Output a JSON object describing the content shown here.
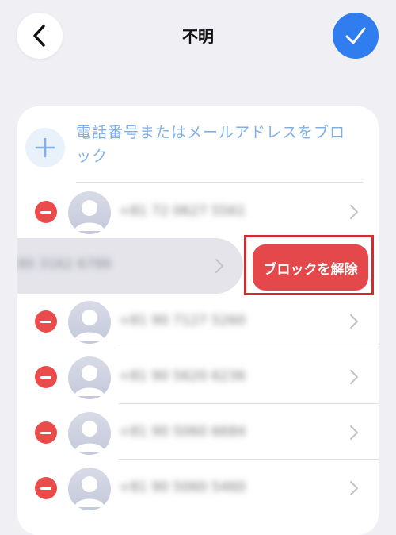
{
  "header": {
    "title": "不明",
    "back_icon": "chevron-left-icon",
    "confirm_icon": "checkmark-icon"
  },
  "add_entry": {
    "label": "電話番号またはメールアドレスをブロック",
    "icon": "plus-icon"
  },
  "swipe_action": {
    "label": "ブロックを解除",
    "color": "#e5484b"
  },
  "blocked_contacts": [
    {
      "text": "+81 72 0627 5561",
      "remove_icon": "remove-minus-icon",
      "chevron": "chevron-right-icon"
    },
    {
      "text": "80 3162 6786",
      "swiped": true,
      "chevron": "chevron-right-icon"
    },
    {
      "text": "+81 90 7127 5260",
      "remove_icon": "remove-minus-icon",
      "chevron": "chevron-right-icon"
    },
    {
      "text": "+81 90 5620 6236",
      "remove_icon": "remove-minus-icon",
      "chevron": "chevron-right-icon"
    },
    {
      "text": "+81 90 5060 6684",
      "remove_icon": "remove-minus-icon",
      "chevron": "chevron-right-icon"
    },
    {
      "text": "+81 90 5060 5460",
      "remove_icon": "remove-minus-icon",
      "chevron": "chevron-right-icon"
    }
  ],
  "colors": {
    "background": "#efeff4",
    "accent": "#2f7dee",
    "destructive": "#ea4b4b",
    "add_text": "#7fb0e6"
  }
}
